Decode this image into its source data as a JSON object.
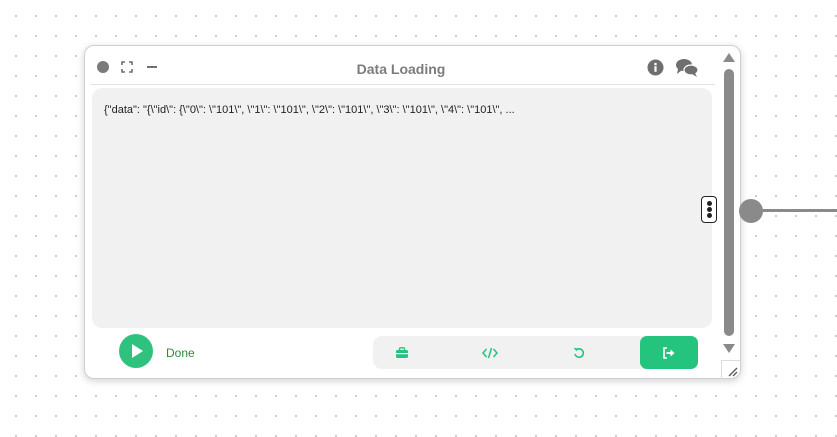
{
  "node": {
    "title": "Data Loading",
    "content_text": "{\"data\": \"{\\\"id\\\": {\\\"0\\\": \\\"101\\\", \\\"1\\\": \\\"101\\\", \\\"2\\\": \\\"101\\\", \\\"3\\\": \\\"101\\\", \\\"4\\\": \\\"101\\\", ...",
    "status": "Done"
  },
  "icons": {
    "window_dot": "circle-icon",
    "expand": "expand-icon",
    "minimize": "minimize-icon",
    "info": "info-icon",
    "chat": "chat-icon",
    "run": "play-icon",
    "toolbox": "toolbox-icon",
    "code": "code-icon",
    "reset": "undo-icon",
    "exit": "sign-out-icon",
    "handle": "drag-handle-icon"
  },
  "colors": {
    "accent": "#24c47f",
    "status_text": "#2b8a3e",
    "title_text": "#7c7c7c",
    "content_bg": "#f1f1f1"
  }
}
